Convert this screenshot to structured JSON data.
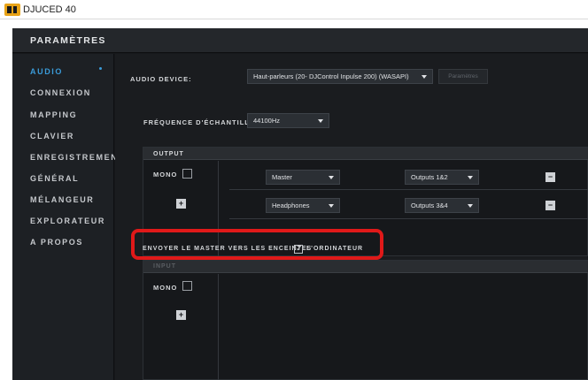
{
  "app": {
    "title": "DJUCED 40"
  },
  "header": {
    "title": "PARAMÈTRES"
  },
  "sidebar": {
    "items": [
      {
        "label": "AUDIO",
        "active": true
      },
      {
        "label": "CONNEXION"
      },
      {
        "label": "MAPPING"
      },
      {
        "label": "CLAVIER"
      },
      {
        "label": "ENREGISTREMENT"
      },
      {
        "label": "GÉNÉRAL"
      },
      {
        "label": "MÉLANGEUR"
      },
      {
        "label": "EXPLORATEUR"
      },
      {
        "label": "A PROPOS"
      }
    ]
  },
  "audio": {
    "device_label": "AUDIO DEVICE:",
    "device_value": "Haut-parleurs (20- DJControl Inpulse 200) (WASAPI)",
    "parametres_button": "Paramètres",
    "sample_rate_label": "FRÉQUENCE D'ÉCHANTILLONN",
    "sample_rate_value": "44100Hz"
  },
  "output": {
    "title": "OUTPUT",
    "mono_label": "MONO",
    "rows": [
      {
        "channel": "Master",
        "outputs": "Outputs 1&2"
      },
      {
        "channel": "Headphones",
        "outputs": "Outputs 3&4"
      }
    ]
  },
  "master_speakers": {
    "text_before": "ENVOYER LE MASTER VERS LES ENCEINTES",
    "text_after": "L'ORDINATEUR",
    "checked": true
  },
  "input": {
    "title": "INPUT",
    "mono_label": "MONO"
  },
  "colors": {
    "accent": "#3a9bd9",
    "highlight": "#e01919",
    "logo": "#e8a317"
  }
}
